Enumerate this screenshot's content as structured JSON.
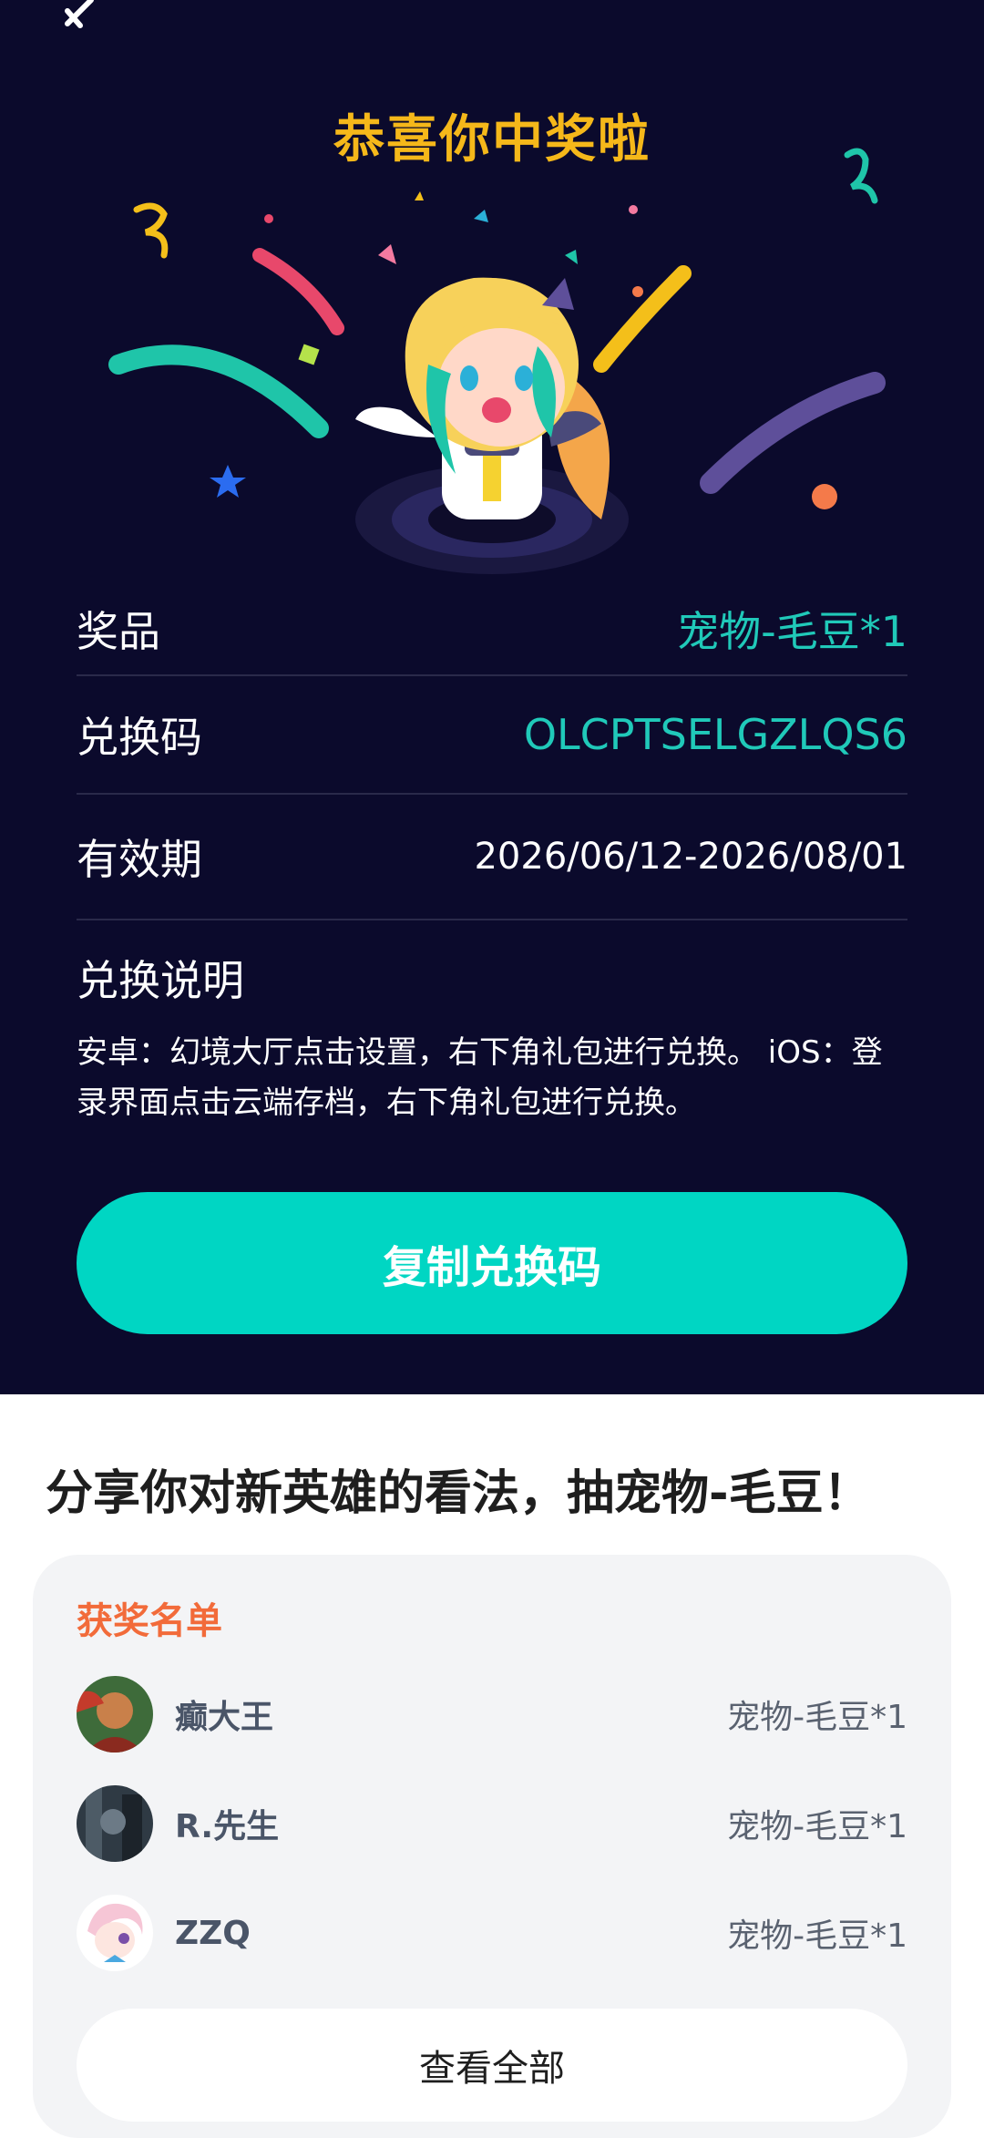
{
  "header": {
    "title": "恭喜你中奖啦"
  },
  "prize": {
    "prize_label": "奖品",
    "prize_value": "宠物-毛豆*1",
    "code_label": "兑换码",
    "code_value": "OLCPTSELGZLQS6",
    "validity_label": "有效期",
    "validity_value": "2026/06/12-2026/08/01",
    "instructions_label": "兑换说明",
    "instructions_text": "安卓：幻境大厅点击设置，右下角礼包进行兑换。 iOS：登录界面点击云端存档，右下角礼包进行兑换。",
    "copy_button": "复制兑换码"
  },
  "share": {
    "headline": "分享你对新英雄的看法，抽宠物-毛豆！"
  },
  "winners": {
    "title": "获奖名单",
    "items": [
      {
        "name": "癫大王",
        "prize": "宠物-毛豆*1"
      },
      {
        "name": "R.先生",
        "prize": "宠物-毛豆*1"
      },
      {
        "name": "ZZQ",
        "prize": "宠物-毛豆*1"
      }
    ],
    "view_all": "查看全部"
  },
  "colors": {
    "background": "#0b0a2c",
    "accent": "#00d6c3",
    "title": "#f5b81a",
    "winners_title": "#f26b3a"
  }
}
